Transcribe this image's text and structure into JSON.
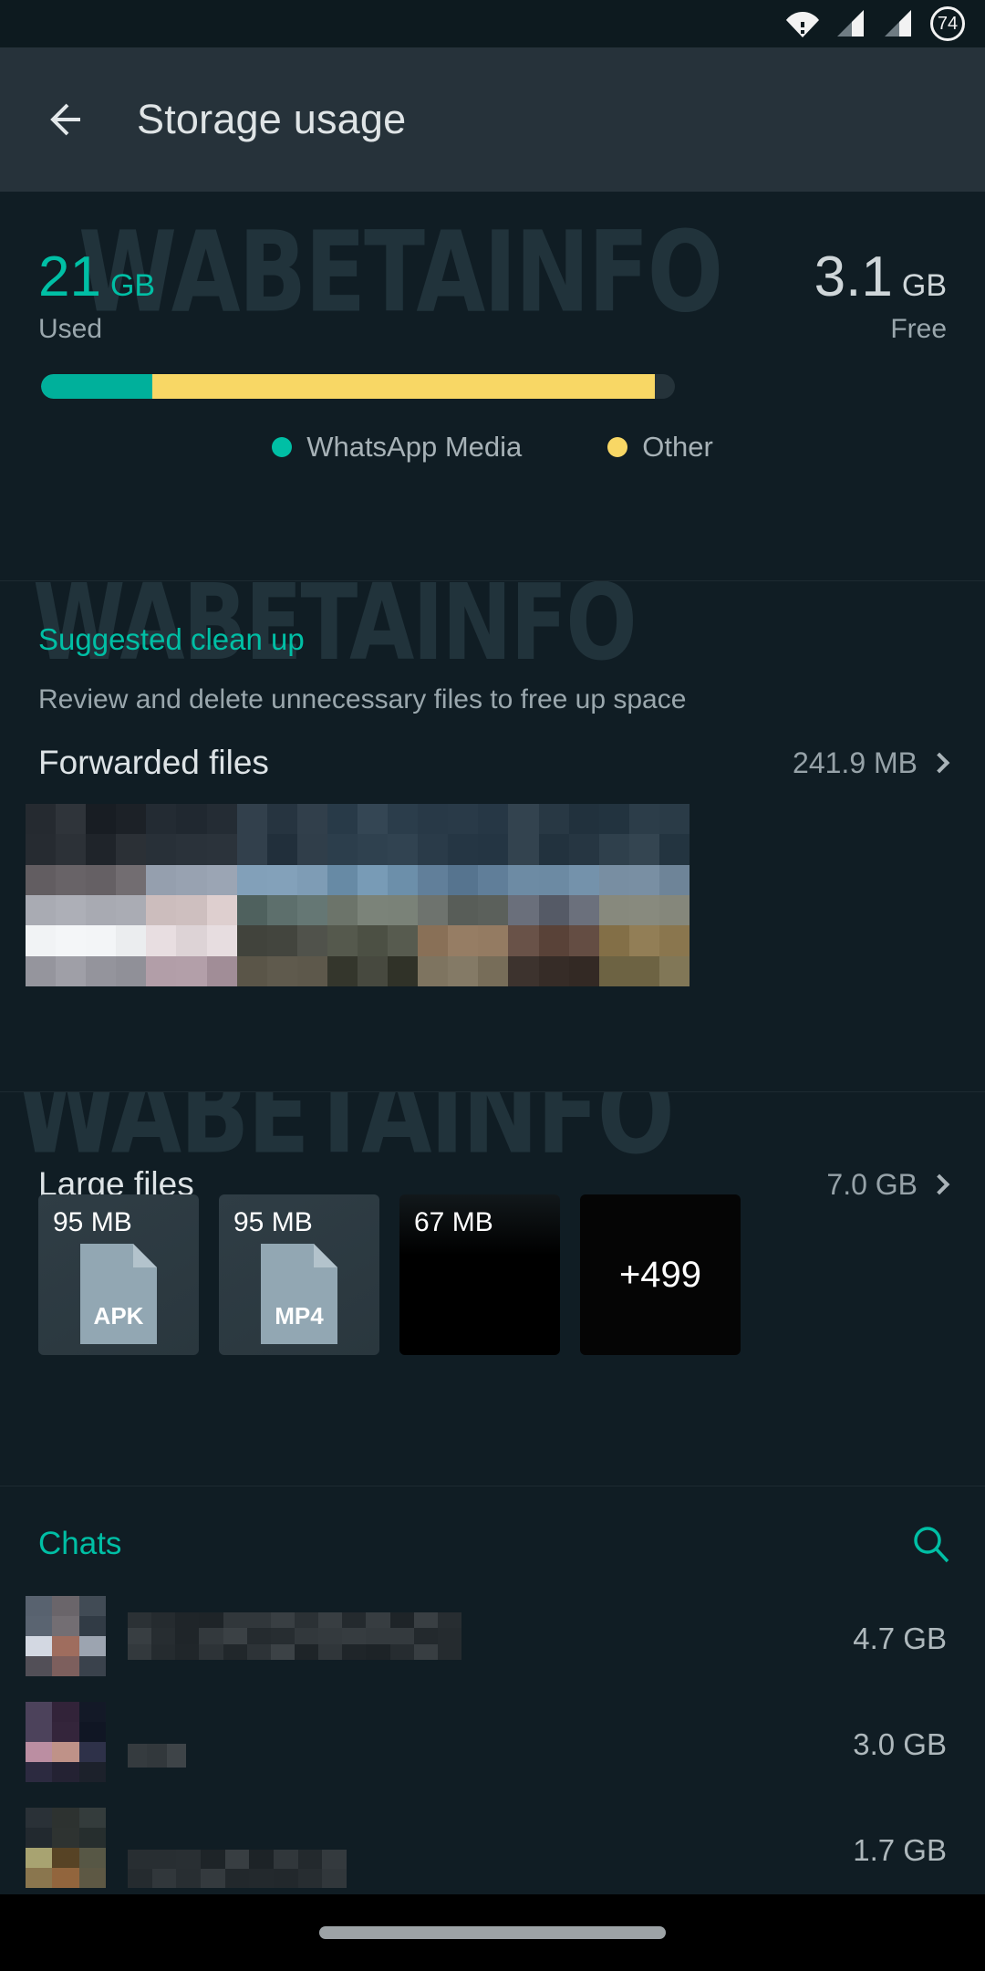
{
  "statusbar": {
    "battery_level": "74",
    "icons": [
      "wifi-icon",
      "signal-icon-1",
      "signal-icon-2",
      "battery-icon"
    ]
  },
  "appbar": {
    "back_icon": "back-arrow-icon",
    "title": "Storage usage"
  },
  "watermark": {
    "text": "WABETAINFO"
  },
  "summary": {
    "used": {
      "value": "21",
      "unit": "GB",
      "label": "Used",
      "color": "#00bfa5"
    },
    "free": {
      "value": "3.1",
      "unit": "GB",
      "label": "Free",
      "color": "#cfd6d9"
    },
    "bar": {
      "segments": [
        {
          "name": "WhatsApp Media",
          "percent": 17.5,
          "color": "#00b09b"
        },
        {
          "name": "Other",
          "percent": 79.3,
          "color": "#f8d765"
        }
      ],
      "track_color": "#25333a"
    },
    "legend": [
      {
        "label": "WhatsApp Media",
        "color": "#00bfa5"
      },
      {
        "label": "Other",
        "color": "#f8d765"
      }
    ]
  },
  "cleanup": {
    "title": "Suggested clean up",
    "subtitle": "Review and delete unnecessary files to free up space",
    "forwarded": {
      "label": "Forwarded files",
      "size": "241.9 MB",
      "chevron_icon": "chevron-right-icon"
    }
  },
  "large_files": {
    "label": "Large files",
    "size": "7.0 GB",
    "chevron_icon": "chevron-right-icon",
    "cards": [
      {
        "size": "95 MB",
        "type": "APK",
        "kind": "doc"
      },
      {
        "size": "95 MB",
        "type": "MP4",
        "kind": "doc"
      },
      {
        "size": "67 MB",
        "type": "",
        "kind": "thumb"
      },
      {
        "size": "",
        "type": "+499",
        "kind": "more"
      }
    ]
  },
  "chats": {
    "title": "Chats",
    "search_icon": "search-icon",
    "rows": [
      {
        "size": "4.7 GB"
      },
      {
        "size": "3.0 GB"
      },
      {
        "size": "1.7 GB"
      }
    ]
  },
  "navbar": {
    "pill": "home-indicator"
  }
}
